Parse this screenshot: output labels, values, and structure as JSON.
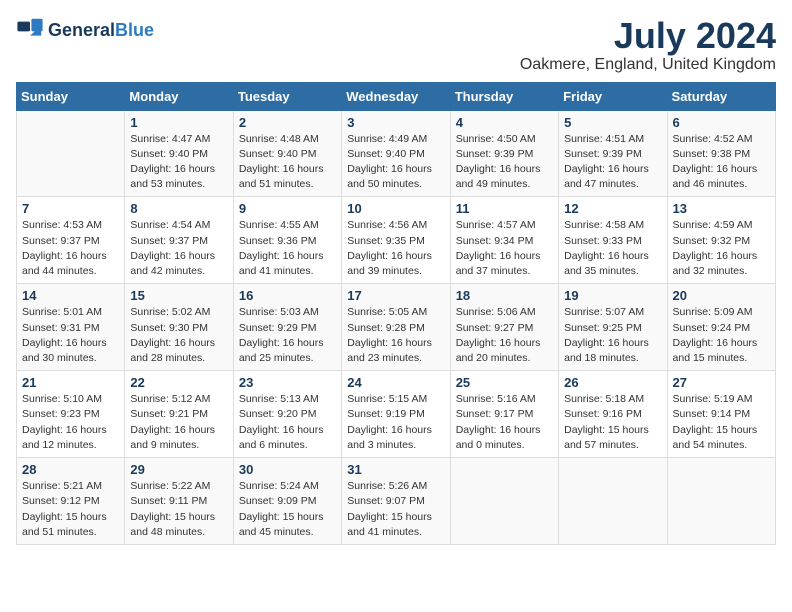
{
  "header": {
    "logo_general": "General",
    "logo_blue": "Blue",
    "title": "July 2024",
    "subtitle": "Oakmere, England, United Kingdom"
  },
  "weekdays": [
    "Sunday",
    "Monday",
    "Tuesday",
    "Wednesday",
    "Thursday",
    "Friday",
    "Saturday"
  ],
  "weeks": [
    [
      {
        "day": "",
        "info": ""
      },
      {
        "day": "1",
        "info": "Sunrise: 4:47 AM\nSunset: 9:40 PM\nDaylight: 16 hours\nand 53 minutes."
      },
      {
        "day": "2",
        "info": "Sunrise: 4:48 AM\nSunset: 9:40 PM\nDaylight: 16 hours\nand 51 minutes."
      },
      {
        "day": "3",
        "info": "Sunrise: 4:49 AM\nSunset: 9:40 PM\nDaylight: 16 hours\nand 50 minutes."
      },
      {
        "day": "4",
        "info": "Sunrise: 4:50 AM\nSunset: 9:39 PM\nDaylight: 16 hours\nand 49 minutes."
      },
      {
        "day": "5",
        "info": "Sunrise: 4:51 AM\nSunset: 9:39 PM\nDaylight: 16 hours\nand 47 minutes."
      },
      {
        "day": "6",
        "info": "Sunrise: 4:52 AM\nSunset: 9:38 PM\nDaylight: 16 hours\nand 46 minutes."
      }
    ],
    [
      {
        "day": "7",
        "info": "Sunrise: 4:53 AM\nSunset: 9:37 PM\nDaylight: 16 hours\nand 44 minutes."
      },
      {
        "day": "8",
        "info": "Sunrise: 4:54 AM\nSunset: 9:37 PM\nDaylight: 16 hours\nand 42 minutes."
      },
      {
        "day": "9",
        "info": "Sunrise: 4:55 AM\nSunset: 9:36 PM\nDaylight: 16 hours\nand 41 minutes."
      },
      {
        "day": "10",
        "info": "Sunrise: 4:56 AM\nSunset: 9:35 PM\nDaylight: 16 hours\nand 39 minutes."
      },
      {
        "day": "11",
        "info": "Sunrise: 4:57 AM\nSunset: 9:34 PM\nDaylight: 16 hours\nand 37 minutes."
      },
      {
        "day": "12",
        "info": "Sunrise: 4:58 AM\nSunset: 9:33 PM\nDaylight: 16 hours\nand 35 minutes."
      },
      {
        "day": "13",
        "info": "Sunrise: 4:59 AM\nSunset: 9:32 PM\nDaylight: 16 hours\nand 32 minutes."
      }
    ],
    [
      {
        "day": "14",
        "info": "Sunrise: 5:01 AM\nSunset: 9:31 PM\nDaylight: 16 hours\nand 30 minutes."
      },
      {
        "day": "15",
        "info": "Sunrise: 5:02 AM\nSunset: 9:30 PM\nDaylight: 16 hours\nand 28 minutes."
      },
      {
        "day": "16",
        "info": "Sunrise: 5:03 AM\nSunset: 9:29 PM\nDaylight: 16 hours\nand 25 minutes."
      },
      {
        "day": "17",
        "info": "Sunrise: 5:05 AM\nSunset: 9:28 PM\nDaylight: 16 hours\nand 23 minutes."
      },
      {
        "day": "18",
        "info": "Sunrise: 5:06 AM\nSunset: 9:27 PM\nDaylight: 16 hours\nand 20 minutes."
      },
      {
        "day": "19",
        "info": "Sunrise: 5:07 AM\nSunset: 9:25 PM\nDaylight: 16 hours\nand 18 minutes."
      },
      {
        "day": "20",
        "info": "Sunrise: 5:09 AM\nSunset: 9:24 PM\nDaylight: 16 hours\nand 15 minutes."
      }
    ],
    [
      {
        "day": "21",
        "info": "Sunrise: 5:10 AM\nSunset: 9:23 PM\nDaylight: 16 hours\nand 12 minutes."
      },
      {
        "day": "22",
        "info": "Sunrise: 5:12 AM\nSunset: 9:21 PM\nDaylight: 16 hours\nand 9 minutes."
      },
      {
        "day": "23",
        "info": "Sunrise: 5:13 AM\nSunset: 9:20 PM\nDaylight: 16 hours\nand 6 minutes."
      },
      {
        "day": "24",
        "info": "Sunrise: 5:15 AM\nSunset: 9:19 PM\nDaylight: 16 hours\nand 3 minutes."
      },
      {
        "day": "25",
        "info": "Sunrise: 5:16 AM\nSunset: 9:17 PM\nDaylight: 16 hours\nand 0 minutes."
      },
      {
        "day": "26",
        "info": "Sunrise: 5:18 AM\nSunset: 9:16 PM\nDaylight: 15 hours\nand 57 minutes."
      },
      {
        "day": "27",
        "info": "Sunrise: 5:19 AM\nSunset: 9:14 PM\nDaylight: 15 hours\nand 54 minutes."
      }
    ],
    [
      {
        "day": "28",
        "info": "Sunrise: 5:21 AM\nSunset: 9:12 PM\nDaylight: 15 hours\nand 51 minutes."
      },
      {
        "day": "29",
        "info": "Sunrise: 5:22 AM\nSunset: 9:11 PM\nDaylight: 15 hours\nand 48 minutes."
      },
      {
        "day": "30",
        "info": "Sunrise: 5:24 AM\nSunset: 9:09 PM\nDaylight: 15 hours\nand 45 minutes."
      },
      {
        "day": "31",
        "info": "Sunrise: 5:26 AM\nSunset: 9:07 PM\nDaylight: 15 hours\nand 41 minutes."
      },
      {
        "day": "",
        "info": ""
      },
      {
        "day": "",
        "info": ""
      },
      {
        "day": "",
        "info": ""
      }
    ]
  ]
}
